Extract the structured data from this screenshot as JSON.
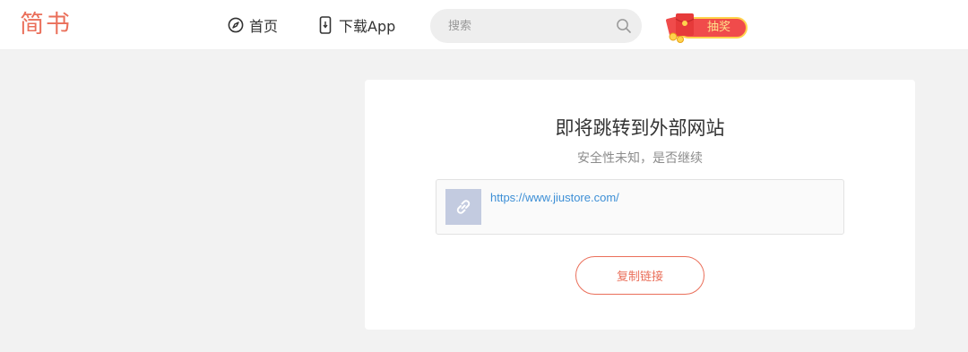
{
  "header": {
    "logo": "简书",
    "nav": {
      "home_label": "首页",
      "home_icon": "compass-icon",
      "download_label": "下载App",
      "download_icon": "phone-icon"
    },
    "search": {
      "placeholder": "搜索",
      "icon": "search-icon"
    },
    "lottery": {
      "label": "抽奖",
      "icon": "red-envelope-icon"
    }
  },
  "redirect": {
    "title": "即将跳转到外部网站",
    "subtitle": "安全性未知，是否继续",
    "url": "https://www.jiustore.com/",
    "link_icon": "link-icon",
    "copy_button": "复制链接"
  },
  "colors": {
    "brand": "#ea6f5a",
    "link": "#3d8fd6",
    "page_bg": "#f2f2f2",
    "thumb_bg": "#c3cbe0",
    "lottery_red": "#f04b4b",
    "lottery_gold": "#ffd34d"
  }
}
